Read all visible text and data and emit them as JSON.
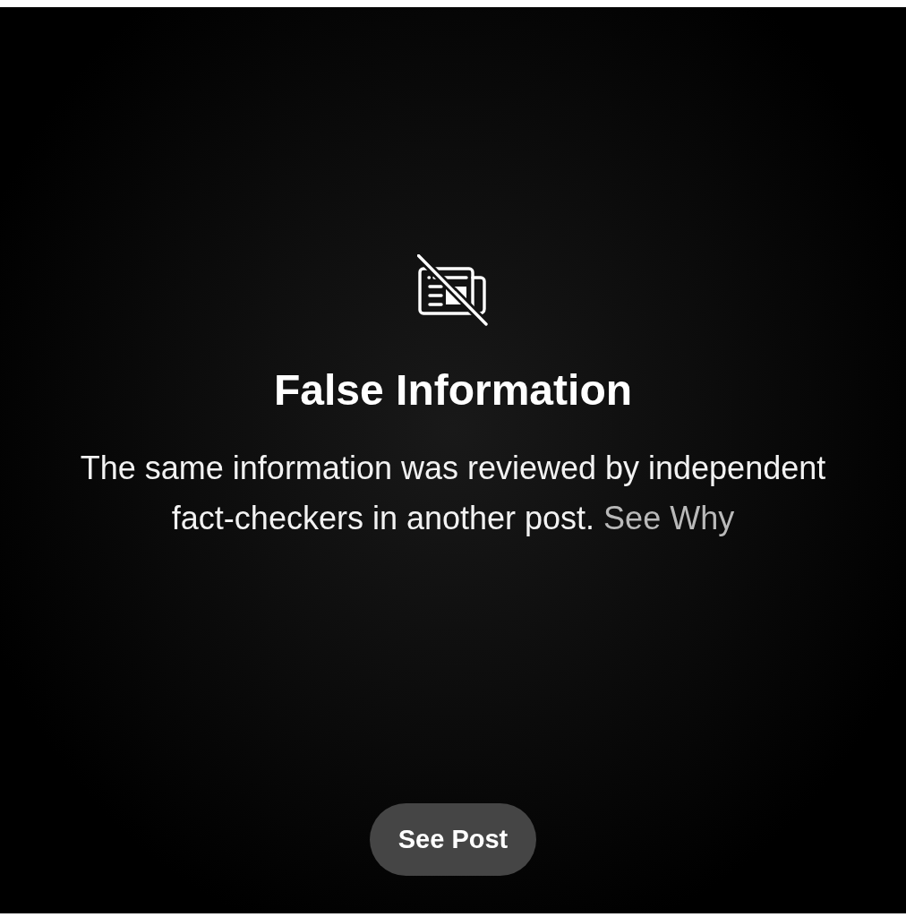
{
  "notice": {
    "title": "False Information",
    "message": "The same information was reviewed by independent fact-checkers in another post.",
    "link": "See Why"
  },
  "button": {
    "label": "See Post"
  }
}
